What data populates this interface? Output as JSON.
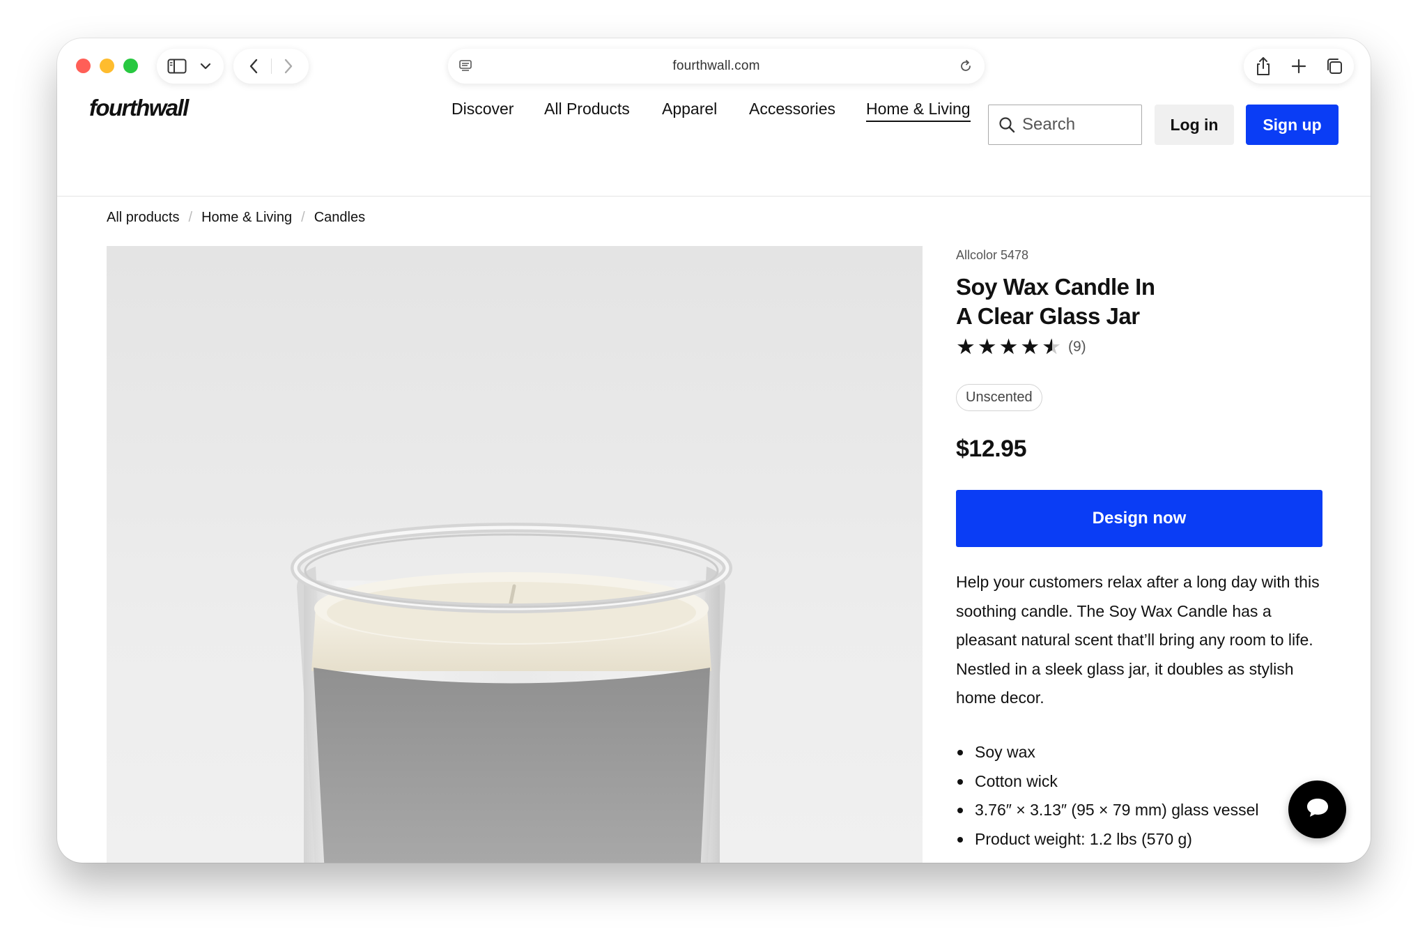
{
  "browser": {
    "url": "fourthwall.com"
  },
  "header": {
    "logo": "fourthwall",
    "nav": [
      {
        "label": "Discover"
      },
      {
        "label": "All Products"
      },
      {
        "label": "Apparel"
      },
      {
        "label": "Accessories"
      },
      {
        "label": "Home & Living",
        "active": true
      }
    ],
    "search": {
      "placeholder": "Search"
    },
    "login_label": "Log in",
    "signup_label": "Sign up"
  },
  "breadcrumb": [
    "All products",
    "Home & Living",
    "Candles"
  ],
  "product": {
    "sku": "Allcolor 5478",
    "title_line1": "Soy Wax Candle In",
    "title_line2": "A Clear Glass Jar",
    "rating": 4.5,
    "rating_count": "(9)",
    "variant": "Unscented",
    "price": "$12.95",
    "cta_label": "Design now",
    "description": "Help your customers relax after a long day with this soothing candle. The Soy Wax Candle has a pleasant natural scent that’ll bring any room to life. Nestled in a sleek glass jar, it doubles as stylish home decor.",
    "features": [
      "Soy wax",
      "Cotton wick",
      "3.76″ × 3.13″ (95 × 79 mm) glass vessel",
      "Product weight: 1.2 lbs (570 g)"
    ]
  },
  "colors": {
    "primary": "#0a3df5",
    "label_gray": "#8e8e8e",
    "wax": "#f3efe3"
  },
  "icons": [
    "sidebar-icon",
    "chevron-down-icon",
    "back-icon",
    "forward-icon",
    "page-icon",
    "reload-icon",
    "share-icon",
    "new-tab-icon",
    "tabs-icon",
    "search-icon",
    "chat-icon"
  ]
}
